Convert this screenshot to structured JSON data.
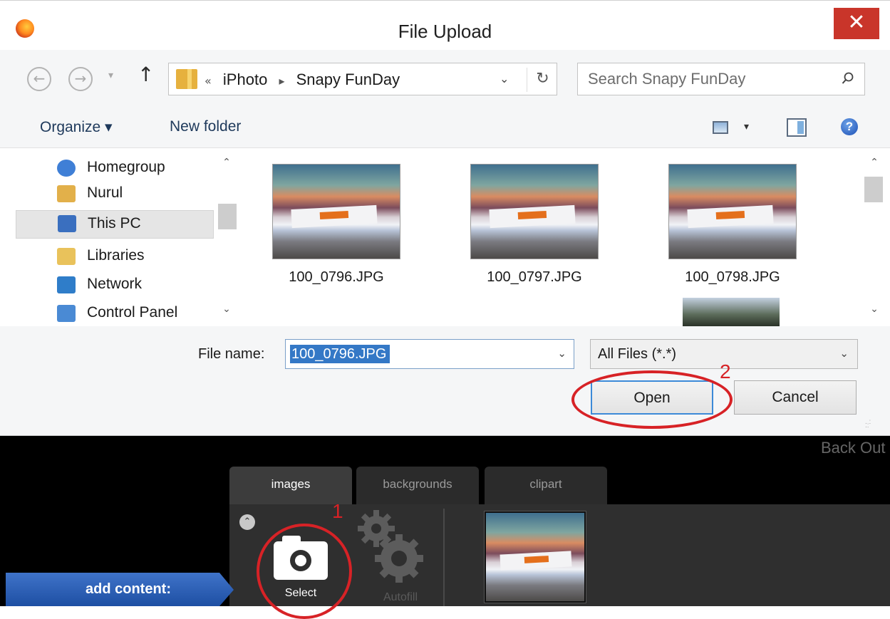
{
  "dialog": {
    "title": "File Upload",
    "close_label": "✕",
    "nav": {
      "back": "←",
      "forward": "→",
      "recent": "▾",
      "up": "↑"
    },
    "breadcrumb": {
      "prefix": "«",
      "items": [
        "iPhoto",
        "Snapy FunDay"
      ],
      "separator": "▸"
    },
    "address_dropdown": "⌄",
    "refresh": "↻",
    "search": {
      "placeholder": "Search Snapy FunDay"
    },
    "toolbar": {
      "organize_label": "Organize ▾",
      "new_folder_label": "New folder",
      "view_dropdown": "▾",
      "help_label": "?"
    },
    "nav_pane": {
      "items": [
        {
          "label": "Homegroup",
          "icon": "homegroup-icon",
          "color": "#3f7fd6"
        },
        {
          "label": "Nurul",
          "icon": "user-folder-icon",
          "color": "#e2b04a"
        },
        {
          "label": "This PC",
          "icon": "computer-icon",
          "color": "#3a6fbf"
        },
        {
          "label": "Libraries",
          "icon": "libraries-icon",
          "color": "#e9c25b"
        },
        {
          "label": "Network",
          "icon": "network-icon",
          "color": "#2f7dc9"
        },
        {
          "label": "Control Panel",
          "icon": "control-panel-icon",
          "color": "#4a8ad4"
        }
      ],
      "selected": "This PC",
      "scroll_up": "⌃",
      "scroll_down": "⌄"
    },
    "files": [
      {
        "name": "100_0796.JPG"
      },
      {
        "name": "100_0797.JPG"
      },
      {
        "name": "100_0798.JPG"
      }
    ],
    "file_name_label": "File name:",
    "file_name_value": "100_0796.JPG",
    "file_type_value": "All Files (*.*)",
    "dropdown_arrow": "⌄",
    "open_label": "Open",
    "cancel_label": "Cancel"
  },
  "annotations": {
    "step1": "1",
    "step2": "2",
    "color": "#d72226"
  },
  "app": {
    "back_out_label": "Back Out",
    "tabs": [
      "images",
      "backgrounds",
      "clipart"
    ],
    "active_tab": "images",
    "collapse_label": "⌃",
    "select_label": "Select",
    "autofill_label": "Autofill",
    "add_content_label": "add content:"
  }
}
